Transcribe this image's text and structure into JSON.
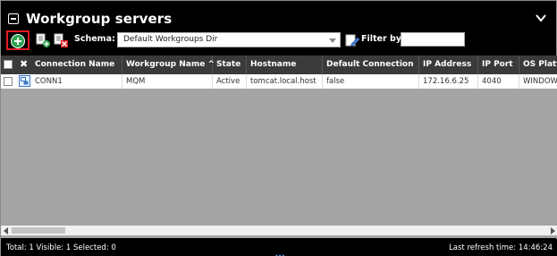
{
  "panel": {
    "title": "Workgroup servers"
  },
  "toolbar": {
    "schema_label": "Schema:",
    "schema_value": "Default Workgroups Dir",
    "filter_label": "Filter by:",
    "filter_value": ""
  },
  "grid": {
    "columns": [
      "Connection Name",
      "Workgroup Name",
      "State",
      "Hostname",
      "Default Connection",
      "IP Address",
      "IP Port",
      "OS Platfo"
    ],
    "sort_indicator": "^",
    "rows": [
      {
        "connection_name": "CONN1",
        "workgroup_name": "MQM",
        "state": "Active",
        "hostname": "tomcat.local.host",
        "default_connection": "false",
        "ip_address": "172.16.6.25",
        "ip_port": "4040",
        "os_platform": "WINDOW"
      }
    ]
  },
  "status": {
    "left": "Total: 1 Visible: 1 Selected: 0",
    "right": "Last refresh time: 14:46:24",
    "handle": "•••"
  },
  "icons": {
    "collapse": "minus-square-icon",
    "expand_toggle": "chevron-down-icon",
    "add": "add-circle-icon",
    "add_connection": "add-connection-icon",
    "delete_connection": "delete-connection-icon",
    "edit_schema": "edit-pencil-icon",
    "row_type": "server-connection-icon"
  },
  "colors": {
    "panel_bg": "#000000",
    "grid_bg": "#a4a4a4",
    "header_bg": "#3a3a3a",
    "add_green": "#2ea44f",
    "highlight_red": "#e21c23"
  }
}
